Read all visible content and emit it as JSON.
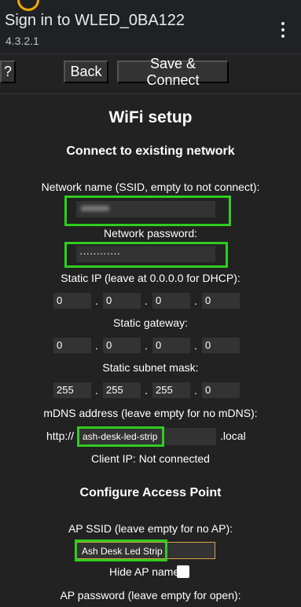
{
  "header": {
    "title": "Sign in to WLED_0BA122",
    "subtitle": "4.3.2.1"
  },
  "toolbar": {
    "help_label": "?",
    "back_label": "Back",
    "save_label": "Save & Connect"
  },
  "page": {
    "title": "WiFi setup"
  },
  "existing_network": {
    "heading": "Connect to existing network",
    "ssid_label": "Network name (SSID, empty to not connect):",
    "ssid_value": "",
    "password_label": "Network password:",
    "password_value": "············",
    "static_ip_label": "Static IP (leave at 0.0.0.0 for DHCP):",
    "static_ip": [
      "0",
      "0",
      "0",
      "0"
    ],
    "gateway_label": "Static gateway:",
    "gateway": [
      "0",
      "0",
      "0",
      "0"
    ],
    "subnet_label": "Static subnet mask:",
    "subnet": [
      "255",
      "255",
      "255",
      "0"
    ],
    "mdns_label": "mDNS address (leave empty for no mDNS):",
    "mdns_prefix": "http://",
    "mdns_value": "ash-desk-led-strip",
    "mdns_suffix": ".local",
    "client_ip": "Client IP: Not connected"
  },
  "access_point": {
    "heading": "Configure Access Point",
    "ssid_label": "AP SSID (leave empty for no AP):",
    "ssid_value": "Ash Desk Led Strip",
    "hide_label": "Hide AP name:",
    "password_label": "AP password (leave empty for open):"
  },
  "colors": {
    "background": "#222222",
    "field": "#333333",
    "highlight": "#2fcc20",
    "focus": "#d9a441"
  }
}
